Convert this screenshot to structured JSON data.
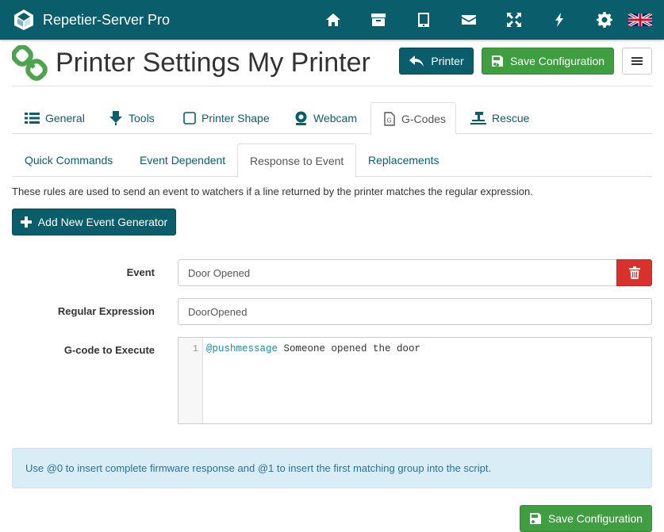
{
  "app": {
    "title": "Repetier-Server Pro"
  },
  "nav_icons": [
    "home-icon",
    "archive-icon",
    "tablet-icon",
    "mail-icon",
    "fullscreen-icon",
    "bolt-icon",
    "gear-icon",
    "uk-flag-icon"
  ],
  "page": {
    "title": "Printer Settings My Printer"
  },
  "header_buttons": {
    "printer": "Printer",
    "save": "Save Configuration"
  },
  "tabs": [
    {
      "label": "General",
      "icon": "list-icon"
    },
    {
      "label": "Tools",
      "icon": "extruder-icon"
    },
    {
      "label": "Printer Shape",
      "icon": "square-icon"
    },
    {
      "label": "Webcam",
      "icon": "webcam-icon"
    },
    {
      "label": "G-Codes",
      "icon": "gcode-file-icon",
      "active": true
    },
    {
      "label": "Rescue",
      "icon": "rescue-icon"
    }
  ],
  "subtabs": [
    {
      "label": "Quick Commands"
    },
    {
      "label": "Event Dependent"
    },
    {
      "label": "Response to Event",
      "active": true
    },
    {
      "label": "Replacements"
    }
  ],
  "description": "These rules are used to send an event to watchers if a line returned by the printer matches the regular expression.",
  "add_button": "Add New Event Generator",
  "form": {
    "event_label": "Event",
    "event_value": "Door Opened",
    "regex_label": "Regular Expression",
    "regex_value": "DoorOpened",
    "gcode_label": "G-code to Execute",
    "gcode_line_number": "1",
    "gcode_keyword": "@pushmessage",
    "gcode_rest": " Someone opened the door"
  },
  "info_text": "Use @0 to insert complete firmware response and @1 to insert the first matching group into the script.",
  "footer_save": "Save Configuration",
  "colors": {
    "primary": "#0a5e6c",
    "success": "#3f9e3f",
    "danger": "#d9312b",
    "info_bg": "#d9edf7"
  }
}
